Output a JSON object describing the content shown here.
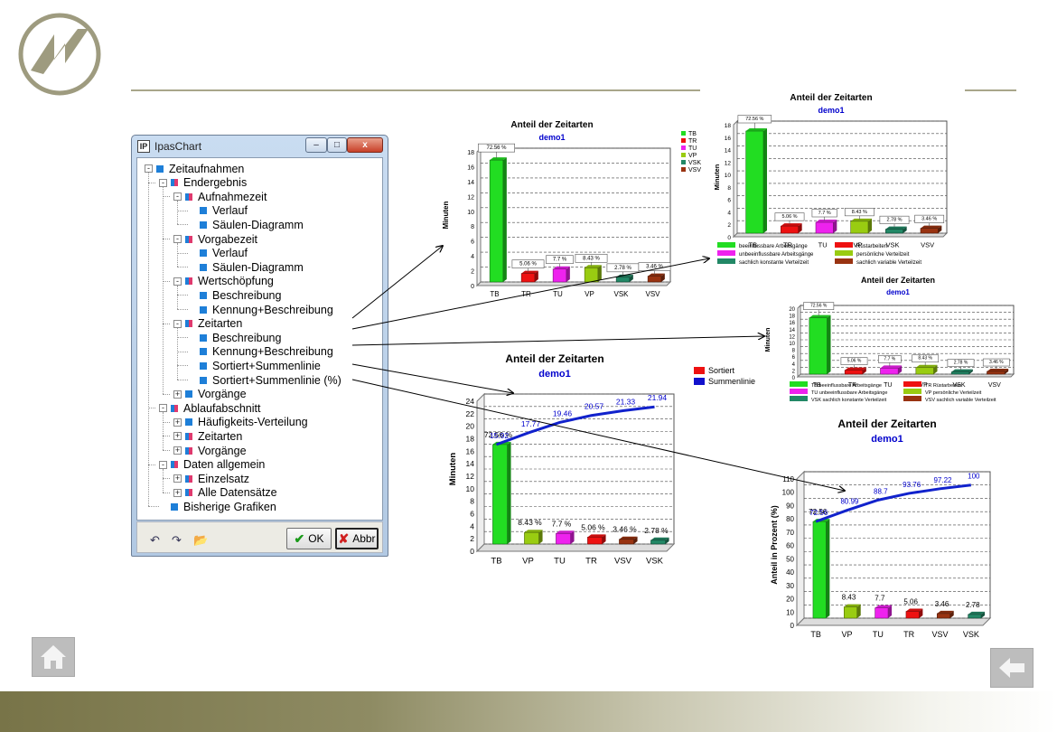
{
  "window": {
    "title": "IpasChart",
    "minimize": "–",
    "maximize": "□",
    "close": "x",
    "ok_label": "OK",
    "cancel_label": "Abbr"
  },
  "tree": [
    {
      "label": "Zeitaufnahmen",
      "level": 0,
      "exp": "-",
      "icon": "blue"
    },
    {
      "label": "Endergebnis",
      "level": 1,
      "exp": "-",
      "icon": "multi"
    },
    {
      "label": "Aufnahmezeit",
      "level": 2,
      "exp": "-",
      "icon": "multi"
    },
    {
      "label": "Verlauf",
      "level": 3,
      "exp": "",
      "icon": "blue"
    },
    {
      "label": "Säulen-Diagramm",
      "level": 3,
      "exp": "",
      "icon": "blue"
    },
    {
      "label": "Vorgabezeit",
      "level": 2,
      "exp": "-",
      "icon": "multi"
    },
    {
      "label": "Verlauf",
      "level": 3,
      "exp": "",
      "icon": "blue"
    },
    {
      "label": "Säulen-Diagramm",
      "level": 3,
      "exp": "",
      "icon": "blue"
    },
    {
      "label": "Wertschöpfung",
      "level": 2,
      "exp": "-",
      "icon": "multi"
    },
    {
      "label": "Beschreibung",
      "level": 3,
      "exp": "",
      "icon": "blue"
    },
    {
      "label": "Kennung+Beschreibung",
      "level": 3,
      "exp": "",
      "icon": "blue"
    },
    {
      "label": "Zeitarten",
      "level": 2,
      "exp": "-",
      "icon": "multi"
    },
    {
      "label": "Beschreibung",
      "level": 3,
      "exp": "",
      "icon": "blue"
    },
    {
      "label": "Kennung+Beschreibung",
      "level": 3,
      "exp": "",
      "icon": "blue"
    },
    {
      "label": "Sortiert+Summenlinie",
      "level": 3,
      "exp": "",
      "icon": "blue"
    },
    {
      "label": "Sortiert+Summenlinie (%)",
      "level": 3,
      "exp": "",
      "icon": "blue"
    },
    {
      "label": "Vorgänge",
      "level": 2,
      "exp": "+",
      "icon": "blue"
    },
    {
      "label": "Ablaufabschnitt",
      "level": 1,
      "exp": "-",
      "icon": "multi"
    },
    {
      "label": "Häufigkeits-Verteilung",
      "level": 2,
      "exp": "+",
      "icon": "blue"
    },
    {
      "label": "Zeitarten",
      "level": 2,
      "exp": "+",
      "icon": "multi"
    },
    {
      "label": "Vorgänge",
      "level": 2,
      "exp": "+",
      "icon": "multi"
    },
    {
      "label": "Daten allgemein",
      "level": 1,
      "exp": "-",
      "icon": "multi"
    },
    {
      "label": "Einzelsatz",
      "level": 2,
      "exp": "+",
      "icon": "multi"
    },
    {
      "label": "Alle Datensätze",
      "level": 2,
      "exp": "+",
      "icon": "multi"
    },
    {
      "label": "Bisherige Grafiken",
      "level": 1,
      "exp": "",
      "icon": "blue"
    }
  ],
  "colors": {
    "TB": "#22dd22",
    "TR": "#ee1111",
    "TU": "#ee22ee",
    "VP": "#99cc11",
    "VSK": "#228866",
    "VSV": "#993311",
    "accent_blue": "#0000cc",
    "line_blue": "#1122cc"
  },
  "chart_data": [
    {
      "type": "bar",
      "title": "Anteil der Zeitarten",
      "subtitle": "demo1",
      "ylabel": "Minuten",
      "ylim": [
        0,
        18
      ],
      "yticks": [
        "0",
        "2",
        "4",
        "6",
        "8",
        "10",
        "12",
        "14",
        "16",
        "18"
      ],
      "categories": [
        "TB",
        "TR",
        "TU",
        "VP",
        "VSK",
        "VSV"
      ],
      "values": [
        16.4,
        1.14,
        1.74,
        1.91,
        0.63,
        0.78
      ],
      "labels": [
        "72.56 %",
        "5.06 %",
        "7.7 %",
        "8.43 %",
        "2.78 %",
        "3.46 %"
      ],
      "legend": [
        "TB",
        "TR",
        "TU",
        "VP",
        "VSK",
        "VSV"
      ],
      "legend_position": "right"
    },
    {
      "type": "bar",
      "title": "Anteil der Zeitarten",
      "subtitle": "demo1",
      "ylabel": "Minuten",
      "ylim": [
        0,
        18
      ],
      "yticks": [
        "0",
        "2",
        "4",
        "6",
        "8",
        "10",
        "12",
        "14",
        "16",
        "18"
      ],
      "categories": [
        "TB",
        "TR",
        "TU",
        "VP",
        "VSK",
        "VSV"
      ],
      "values": [
        16.4,
        1.14,
        1.74,
        1.91,
        0.63,
        0.78
      ],
      "labels": [
        "72.56 %",
        "5.06 %",
        "7.7 %",
        "8.43 %",
        "2.78 %",
        "3.46 %"
      ],
      "legend": [
        "beeinflussbare Arbeitsgänge",
        "Rüstarbeiten",
        "unbeeinflussbare Arbeitsgänge",
        "persönliche Verteilzeit",
        "sachlich konstante Verteilzeit",
        "sachlich variable Verteilzeit"
      ],
      "legend_position": "bottom"
    },
    {
      "type": "bar",
      "title": "Anteil der Zeitarten",
      "subtitle": "demo1",
      "ylabel": "Minuten",
      "ylim": [
        0,
        20
      ],
      "yticks": [
        "0",
        "2",
        "4",
        "6",
        "8",
        "10",
        "12",
        "14",
        "16",
        "18",
        "20"
      ],
      "categories": [
        "TB",
        "TR",
        "TU",
        "VP",
        "VSK",
        "VSV"
      ],
      "values": [
        16.4,
        1.14,
        1.74,
        1.91,
        0.63,
        0.78
      ],
      "labels": [
        "72.56 %",
        "5.06 %",
        "7.7 %",
        "8.43 %",
        "2.78 %",
        "3.46 %"
      ],
      "legend": [
        "TB beeinflussbare Arbeitsgänge",
        "TR Rüstarbeiten",
        "TU unbeeinflussbare Arbeitsgänge",
        "VP persönliche Verteilzeit",
        "VSK sachlich konstante Verteilzeit",
        "VSV sachlich variable Verteilzeit"
      ],
      "legend_position": "bottom"
    },
    {
      "type": "bar",
      "title": "Anteil der Zeitarten",
      "subtitle": "demo1",
      "ylabel": "Minuten",
      "ylim": [
        0,
        24
      ],
      "yticks": [
        "0",
        "2",
        "4",
        "6",
        "8",
        "10",
        "12",
        "14",
        "16",
        "18",
        "20",
        "22",
        "24"
      ],
      "categories": [
        "TB",
        "VP",
        "TU",
        "TR",
        "VSV",
        "VSK"
      ],
      "values": [
        15.92,
        1.85,
        1.69,
        1.11,
        0.76,
        0.61
      ],
      "labels": [
        "72.56 %",
        "8.43 %",
        "7.7 %",
        "5.06 %",
        "3.46 %",
        "2.78 %"
      ],
      "series": [
        {
          "name": "Sortiert",
          "values": [
            15.92,
            1.85,
            1.69,
            1.11,
            0.76,
            0.61
          ]
        },
        {
          "name": "Summenlinie",
          "values": [
            15.92,
            17.77,
            19.46,
            20.57,
            21.33,
            21.94
          ]
        }
      ],
      "line_labels": [
        "15.92",
        "17.77",
        "19.46",
        "20.57",
        "21.33",
        "21.94"
      ],
      "legend_position": "top-right"
    },
    {
      "type": "bar",
      "title": "Anteil der Zeitarten",
      "subtitle": "demo1",
      "ylabel": "Anteil in Prozent (%)",
      "ylim": [
        0,
        110
      ],
      "yticks": [
        "0",
        "10",
        "20",
        "30",
        "40",
        "50",
        "60",
        "70",
        "80",
        "90",
        "100",
        "110"
      ],
      "categories": [
        "TB",
        "VP",
        "TU",
        "TR",
        "VSV",
        "VSK"
      ],
      "values": [
        72.56,
        8.43,
        7.7,
        5.06,
        3.46,
        2.78
      ],
      "labels": [
        "72.56",
        "8.43",
        "7.7",
        "5.06",
        "3.46",
        "2.78"
      ],
      "series": [
        {
          "name": "",
          "values": [
            72.56,
            8.43,
            7.7,
            5.06,
            3.46,
            2.78
          ]
        },
        {
          "name": "",
          "values": [
            72.56,
            80.99,
            88.7,
            93.76,
            97.22,
            100
          ]
        }
      ],
      "line_labels": [
        "72.56",
        "80.99",
        "88.7",
        "93.76",
        "97.22",
        "100"
      ]
    }
  ]
}
